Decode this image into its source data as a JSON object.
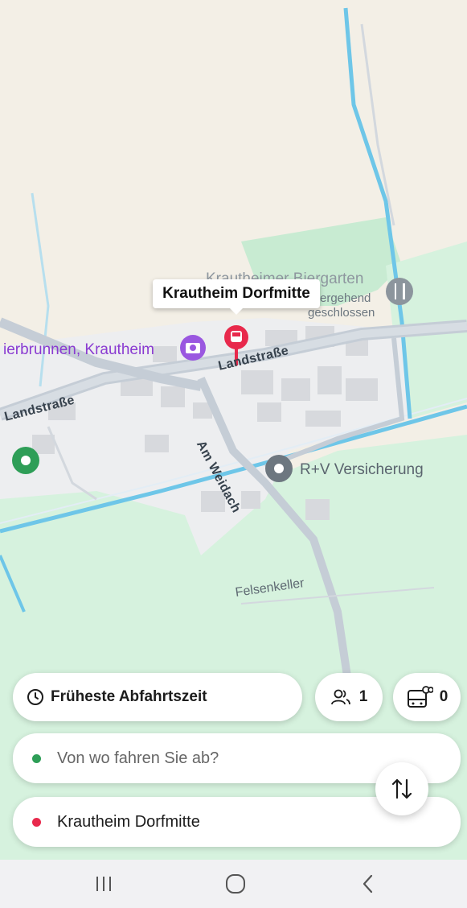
{
  "map": {
    "selected_stop": "Krautheim Dorfmitte",
    "poi_biergarten_name": "Krautheimer Biergarten",
    "poi_biergarten_status_1": "ergehend",
    "poi_biergarten_status_2": "geschlossen",
    "poi_brunnen": "ierbrunnen, Krautheim",
    "poi_versicherung": "R+V Versicherung",
    "road_landstrasse_1": "Landstraße",
    "road_landstrasse_2": "Landstraße",
    "road_am_weidach": "Am Weidach",
    "place_felsenkeller": "Felsenkeller",
    "icons": [
      "bus-stop-pin-icon",
      "camera-icon",
      "restaurant-icon",
      "place-pin-icon",
      "location-pin-icon"
    ]
  },
  "options": {
    "time_label": "Früheste Abfahrtszeit",
    "passengers_count": "1",
    "bikes_count": "0"
  },
  "route": {
    "from_placeholder": "Von wo fahren Sie ab?",
    "to_value": "Krautheim Dorfmitte"
  },
  "colors": {
    "from_dot": "#2e9e57",
    "to_dot": "#e8294c",
    "bus_pin": "#e8294c",
    "water": "#6ec6e8",
    "green_area": "#d4f0dc"
  },
  "navbar": {
    "icons": [
      "recent-apps-icon",
      "home-icon",
      "back-icon"
    ]
  }
}
